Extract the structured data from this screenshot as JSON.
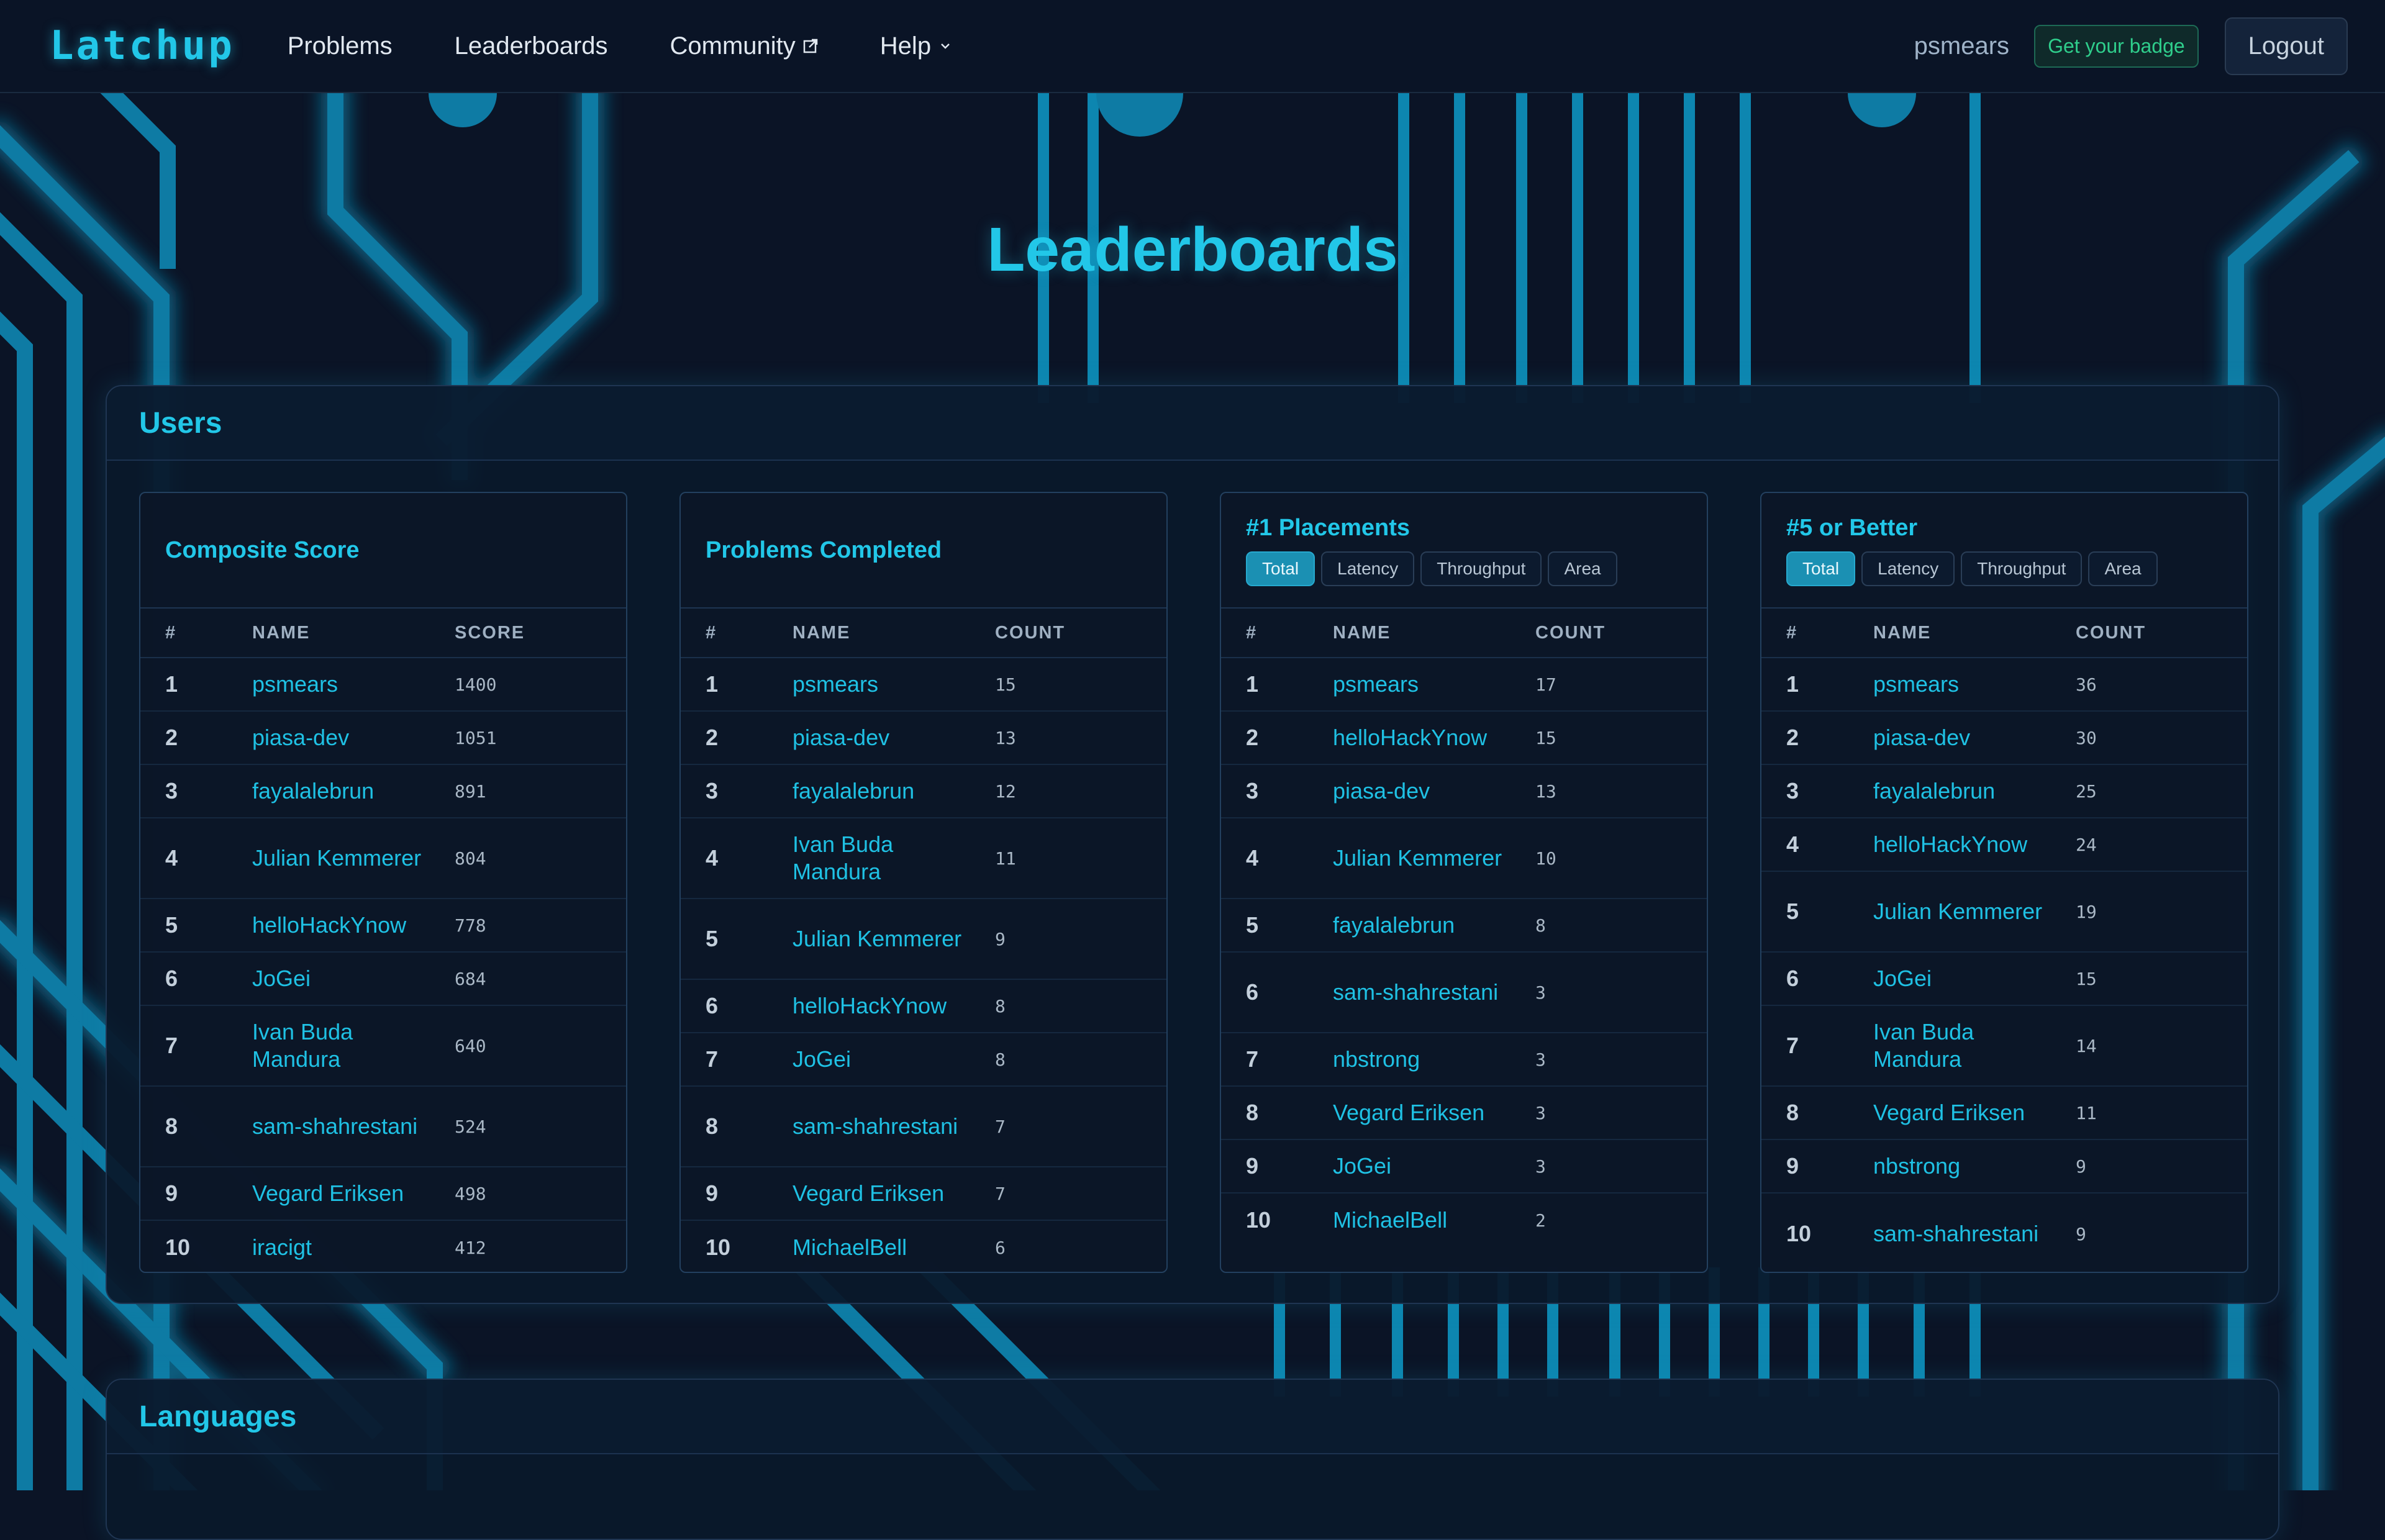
{
  "nav": {
    "brand": "Latchup",
    "links": [
      "Problems",
      "Leaderboards",
      "Community",
      "Help"
    ],
    "username": "psmears",
    "badge_label": "Get your badge",
    "logout_label": "Logout"
  },
  "page_title": "Leaderboards",
  "sections": {
    "users_title": "Users",
    "languages_title": "Languages"
  },
  "table_headers": {
    "rank": "#",
    "name": "NAME",
    "score": "SCORE",
    "count": "COUNT"
  },
  "filters": [
    "Total",
    "Latency",
    "Throughput",
    "Area"
  ],
  "boards": [
    {
      "title": "Composite Score",
      "value_header": "SCORE",
      "rows": [
        {
          "rank": "1",
          "name": "psmears",
          "value": "1400"
        },
        {
          "rank": "2",
          "name": "piasa-dev",
          "value": "1051"
        },
        {
          "rank": "3",
          "name": "fayalalebrun",
          "value": "891"
        },
        {
          "rank": "4",
          "name": "Julian Kemmerer",
          "value": "804"
        },
        {
          "rank": "5",
          "name": "helloHackYnow",
          "value": "778"
        },
        {
          "rank": "6",
          "name": "JoGei",
          "value": "684"
        },
        {
          "rank": "7",
          "name": "Ivan Buda Mandura",
          "value": "640"
        },
        {
          "rank": "8",
          "name": "sam-shahrestani",
          "value": "524"
        },
        {
          "rank": "9",
          "name": "Vegard Eriksen",
          "value": "498"
        },
        {
          "rank": "10",
          "name": "iracigt",
          "value": "412"
        }
      ]
    },
    {
      "title": "Problems Completed",
      "value_header": "COUNT",
      "rows": [
        {
          "rank": "1",
          "name": "psmears",
          "value": "15"
        },
        {
          "rank": "2",
          "name": "piasa-dev",
          "value": "13"
        },
        {
          "rank": "3",
          "name": "fayalalebrun",
          "value": "12"
        },
        {
          "rank": "4",
          "name": "Ivan Buda Mandura",
          "value": "11"
        },
        {
          "rank": "5",
          "name": "Julian Kemmerer",
          "value": "9"
        },
        {
          "rank": "6",
          "name": "helloHackYnow",
          "value": "8"
        },
        {
          "rank": "7",
          "name": "JoGei",
          "value": "8"
        },
        {
          "rank": "8",
          "name": "sam-shahrestani",
          "value": "7"
        },
        {
          "rank": "9",
          "name": "Vegard Eriksen",
          "value": "7"
        },
        {
          "rank": "10",
          "name": "MichaelBell",
          "value": "6"
        }
      ]
    },
    {
      "title": "#1 Placements",
      "value_header": "COUNT",
      "active_filter": "Total",
      "rows": [
        {
          "rank": "1",
          "name": "psmears",
          "value": "17"
        },
        {
          "rank": "2",
          "name": "helloHackYnow",
          "value": "15"
        },
        {
          "rank": "3",
          "name": "piasa-dev",
          "value": "13"
        },
        {
          "rank": "4",
          "name": "Julian Kemmerer",
          "value": "10"
        },
        {
          "rank": "5",
          "name": "fayalalebrun",
          "value": "8"
        },
        {
          "rank": "6",
          "name": "sam-shahrestani",
          "value": "3"
        },
        {
          "rank": "7",
          "name": "nbstrong",
          "value": "3"
        },
        {
          "rank": "8",
          "name": "Vegard Eriksen",
          "value": "3"
        },
        {
          "rank": "9",
          "name": "JoGei",
          "value": "3"
        },
        {
          "rank": "10",
          "name": "MichaelBell",
          "value": "2"
        }
      ]
    },
    {
      "title": "#5 or Better",
      "value_header": "COUNT",
      "active_filter": "Total",
      "rows": [
        {
          "rank": "1",
          "name": "psmears",
          "value": "36"
        },
        {
          "rank": "2",
          "name": "piasa-dev",
          "value": "30"
        },
        {
          "rank": "3",
          "name": "fayalalebrun",
          "value": "25"
        },
        {
          "rank": "4",
          "name": "helloHackYnow",
          "value": "24"
        },
        {
          "rank": "5",
          "name": "Julian Kemmerer",
          "value": "19"
        },
        {
          "rank": "6",
          "name": "JoGei",
          "value": "15"
        },
        {
          "rank": "7",
          "name": "Ivan Buda Mandura",
          "value": "14"
        },
        {
          "rank": "8",
          "name": "Vegard Eriksen",
          "value": "11"
        },
        {
          "rank": "9",
          "name": "nbstrong",
          "value": "9"
        },
        {
          "rank": "10",
          "name": "sam-shahrestani",
          "value": "9"
        }
      ]
    }
  ],
  "colors": {
    "accent": "#22c7e8",
    "background": "#0b1426",
    "badge_green": "#2fce8c",
    "pill_active": "#1b90b3"
  }
}
